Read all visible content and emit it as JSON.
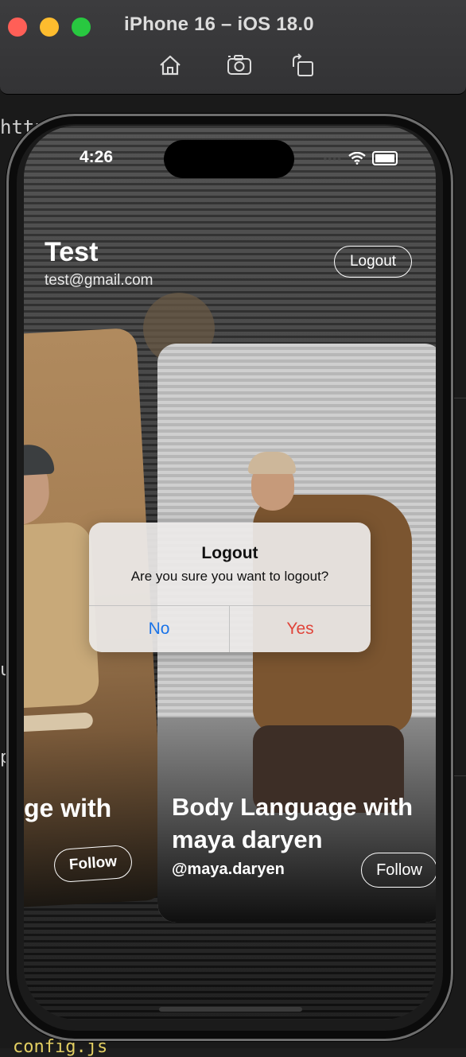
{
  "simulator": {
    "title": "iPhone 16 – iOS 18.0",
    "toolbar": {
      "home_icon": "home-icon",
      "screenshot_icon": "camera-icon",
      "rotate_icon": "rotate-icon"
    }
  },
  "editor_fragments": {
    "top": "http",
    "left_u": "u",
    "left_p": "p",
    "bottom": "config.js"
  },
  "status_bar": {
    "time": "4:26"
  },
  "profile": {
    "name": "Test",
    "email": "test@gmail.com",
    "logout_label": "Logout"
  },
  "cards": [
    {
      "title": "ge with",
      "follow_label": "Follow"
    },
    {
      "title": "Body Language with maya daryen",
      "handle": "@maya.daryen",
      "follow_label": "Follow"
    }
  ],
  "alert": {
    "title": "Logout",
    "message": "Are you sure you want to logout?",
    "no_label": "No",
    "yes_label": "Yes"
  },
  "colors": {
    "alert_no": "#1a73e8",
    "alert_yes": "#e0443a"
  }
}
